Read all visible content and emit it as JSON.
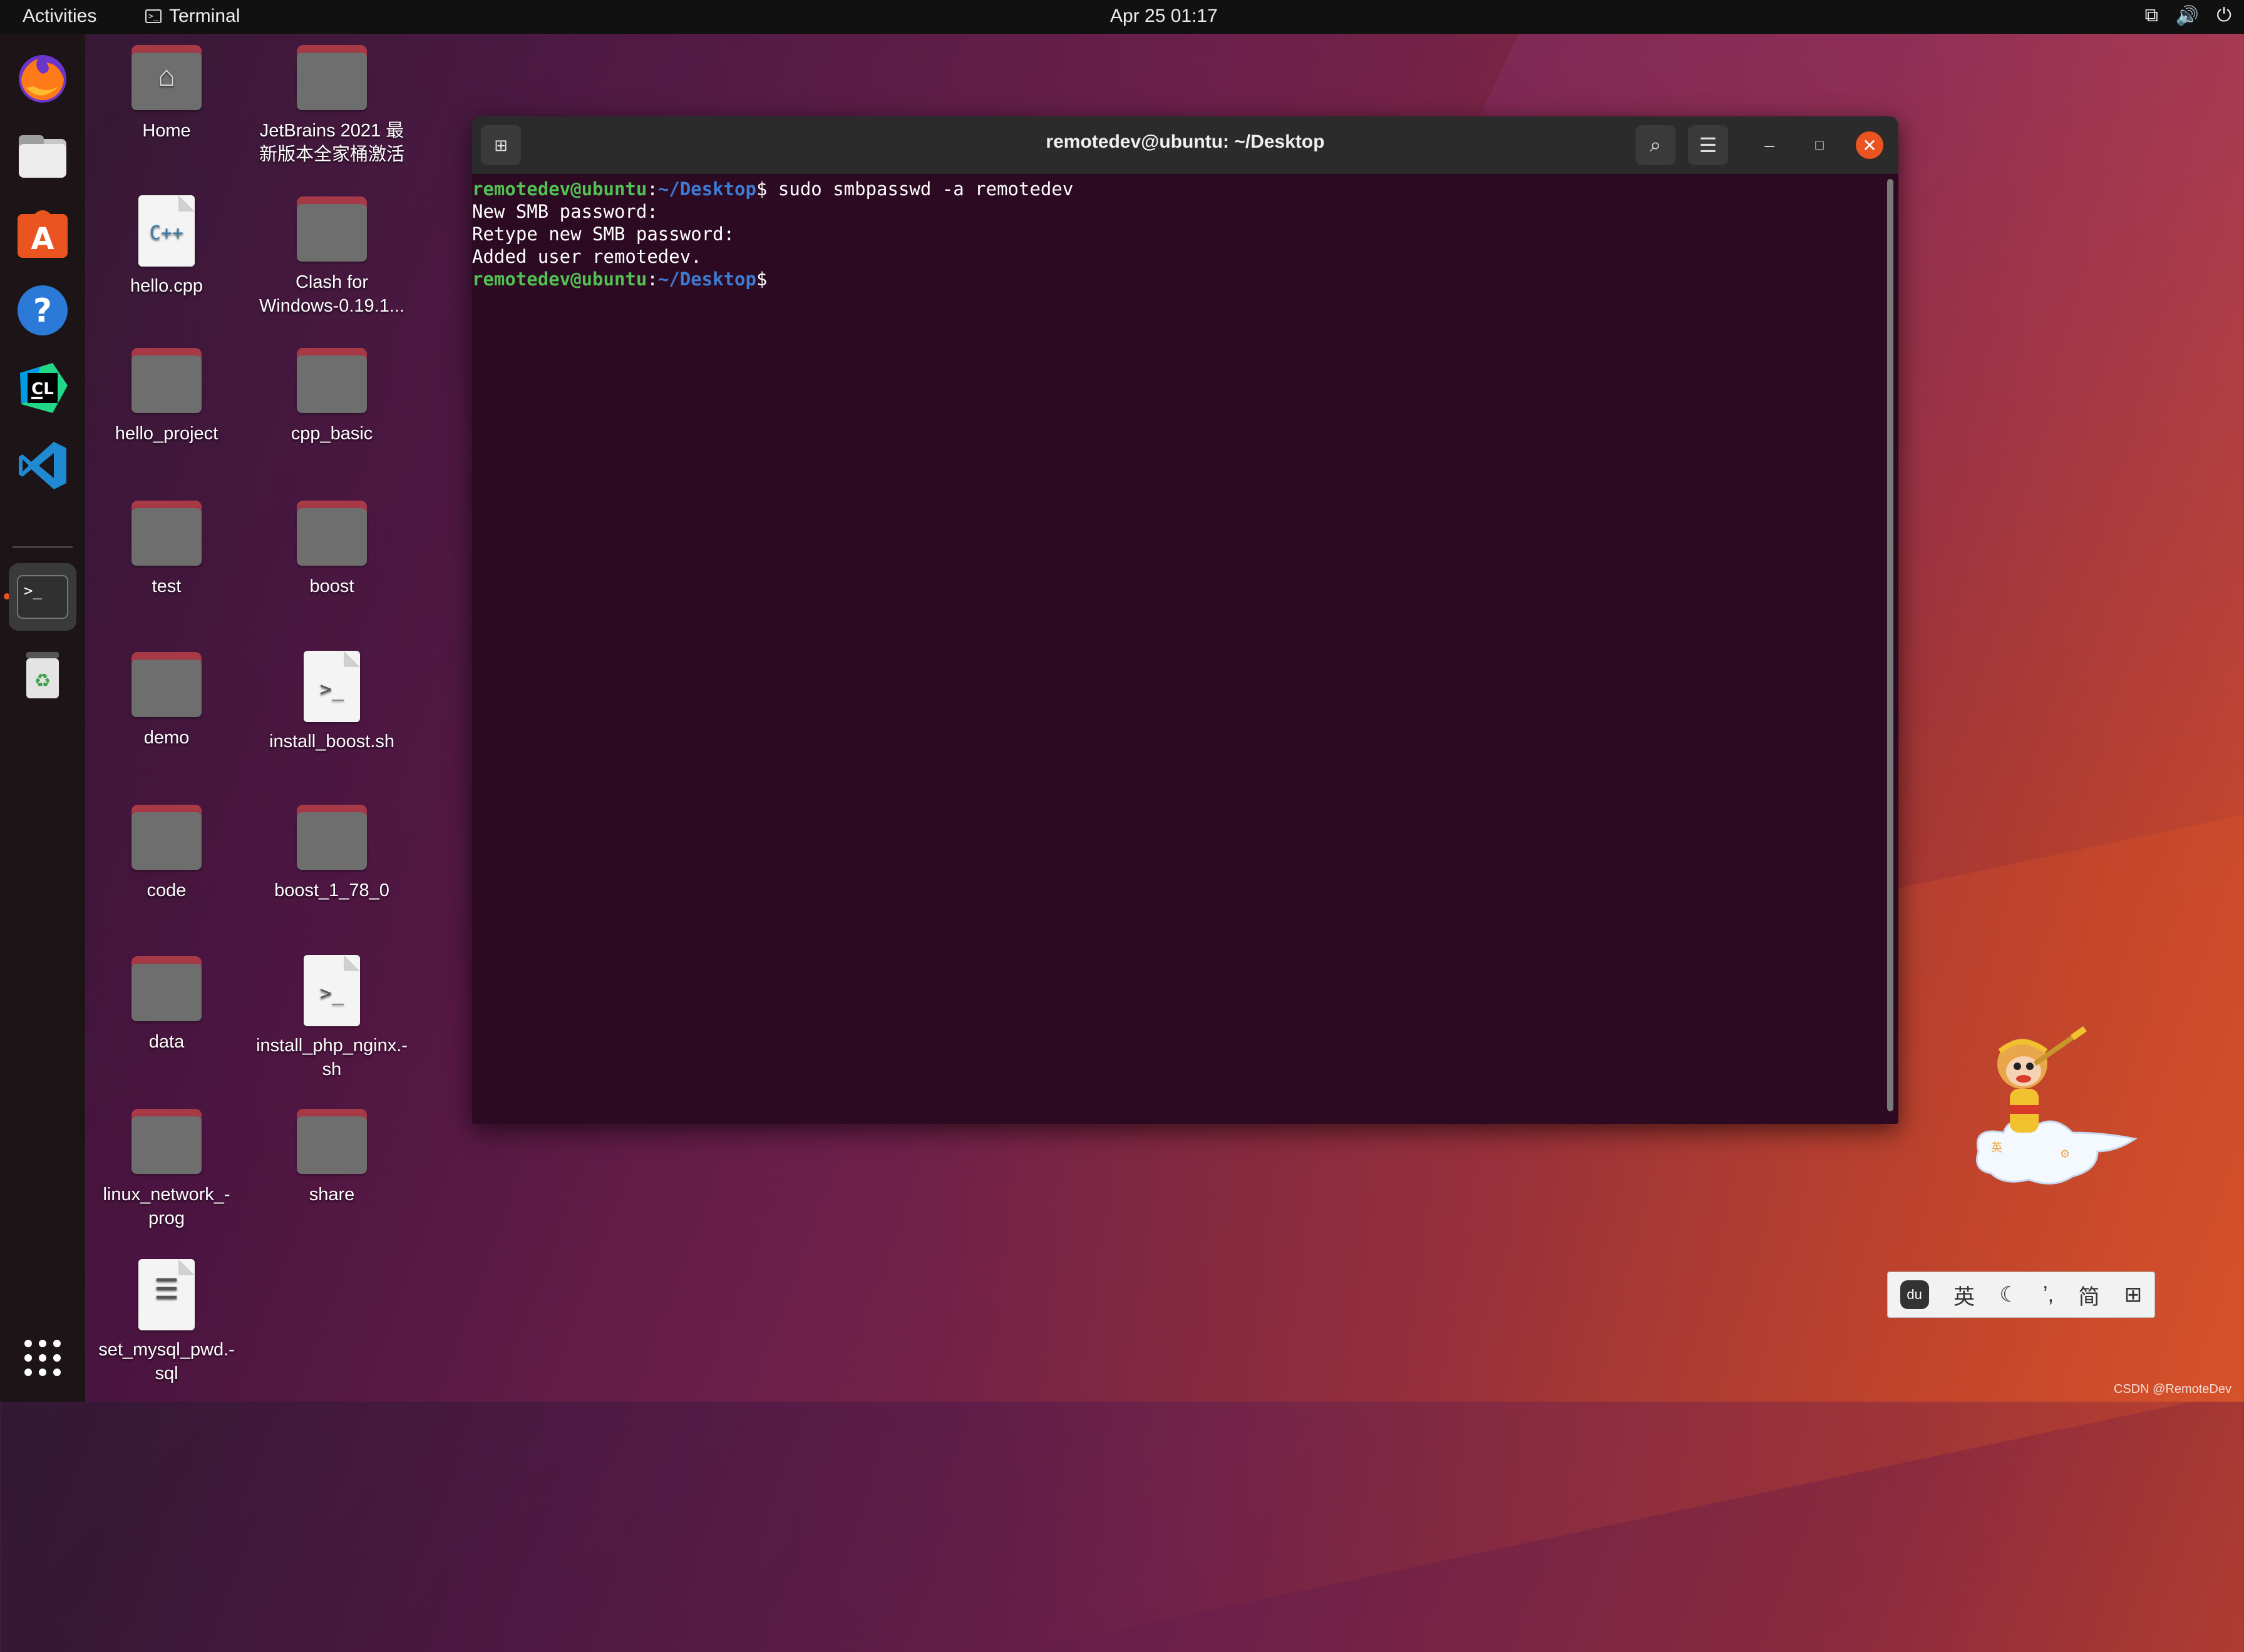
{
  "topbar": {
    "activities": "Activities",
    "app_name": "Terminal",
    "clock": "Apr 25  01:17"
  },
  "dock": {
    "items": [
      {
        "name": "firefox"
      },
      {
        "name": "files"
      },
      {
        "name": "app-center"
      },
      {
        "name": "help"
      },
      {
        "name": "clion"
      },
      {
        "name": "vscode"
      },
      {
        "name": "terminal"
      },
      {
        "name": "trash"
      }
    ]
  },
  "desktop": {
    "col1": [
      {
        "label": "Home",
        "kind": "home"
      },
      {
        "label": "hello.cpp",
        "kind": "cpp"
      },
      {
        "label": "hello_project",
        "kind": "folder"
      },
      {
        "label": "test",
        "kind": "folder"
      },
      {
        "label": "demo",
        "kind": "folder"
      },
      {
        "label": "code",
        "kind": "folder"
      },
      {
        "label": "data",
        "kind": "folder"
      },
      {
        "label": "linux_network_-",
        "label2": "prog",
        "kind": "folder"
      },
      {
        "label": "set_mysql_pwd.-",
        "label2": "sql",
        "kind": "sql"
      }
    ],
    "col2": [
      {
        "label": "JetBrains 2021 最",
        "label2": "新版本全家桶激活",
        "kind": "folder"
      },
      {
        "label": "Clash for",
        "label2": "Windows-0.19.1...",
        "kind": "folder"
      },
      {
        "label": "cpp_basic",
        "kind": "folder"
      },
      {
        "label": "boost",
        "kind": "folder"
      },
      {
        "label": "install_boost.sh",
        "kind": "script"
      },
      {
        "label": "boost_1_78_0",
        "kind": "folder"
      },
      {
        "label": "install_php_nginx.-",
        "label2": "sh",
        "kind": "script"
      },
      {
        "label": "share",
        "kind": "folder"
      }
    ]
  },
  "terminal": {
    "title": "remotedev@ubuntu: ~/Desktop",
    "prompt_user": "remotedev@ubuntu",
    "prompt_sep": ":",
    "prompt_path": "~/Desktop",
    "prompt_end": "$",
    "command": " sudo smbpasswd -a remotedev",
    "output": [
      "New SMB password:",
      "Retype new SMB password:",
      "Added user remotedev."
    ]
  },
  "ime": {
    "lang": "英",
    "punct": "ʼ,",
    "script": "简"
  },
  "watermark": "CSDN @RemoteDev"
}
